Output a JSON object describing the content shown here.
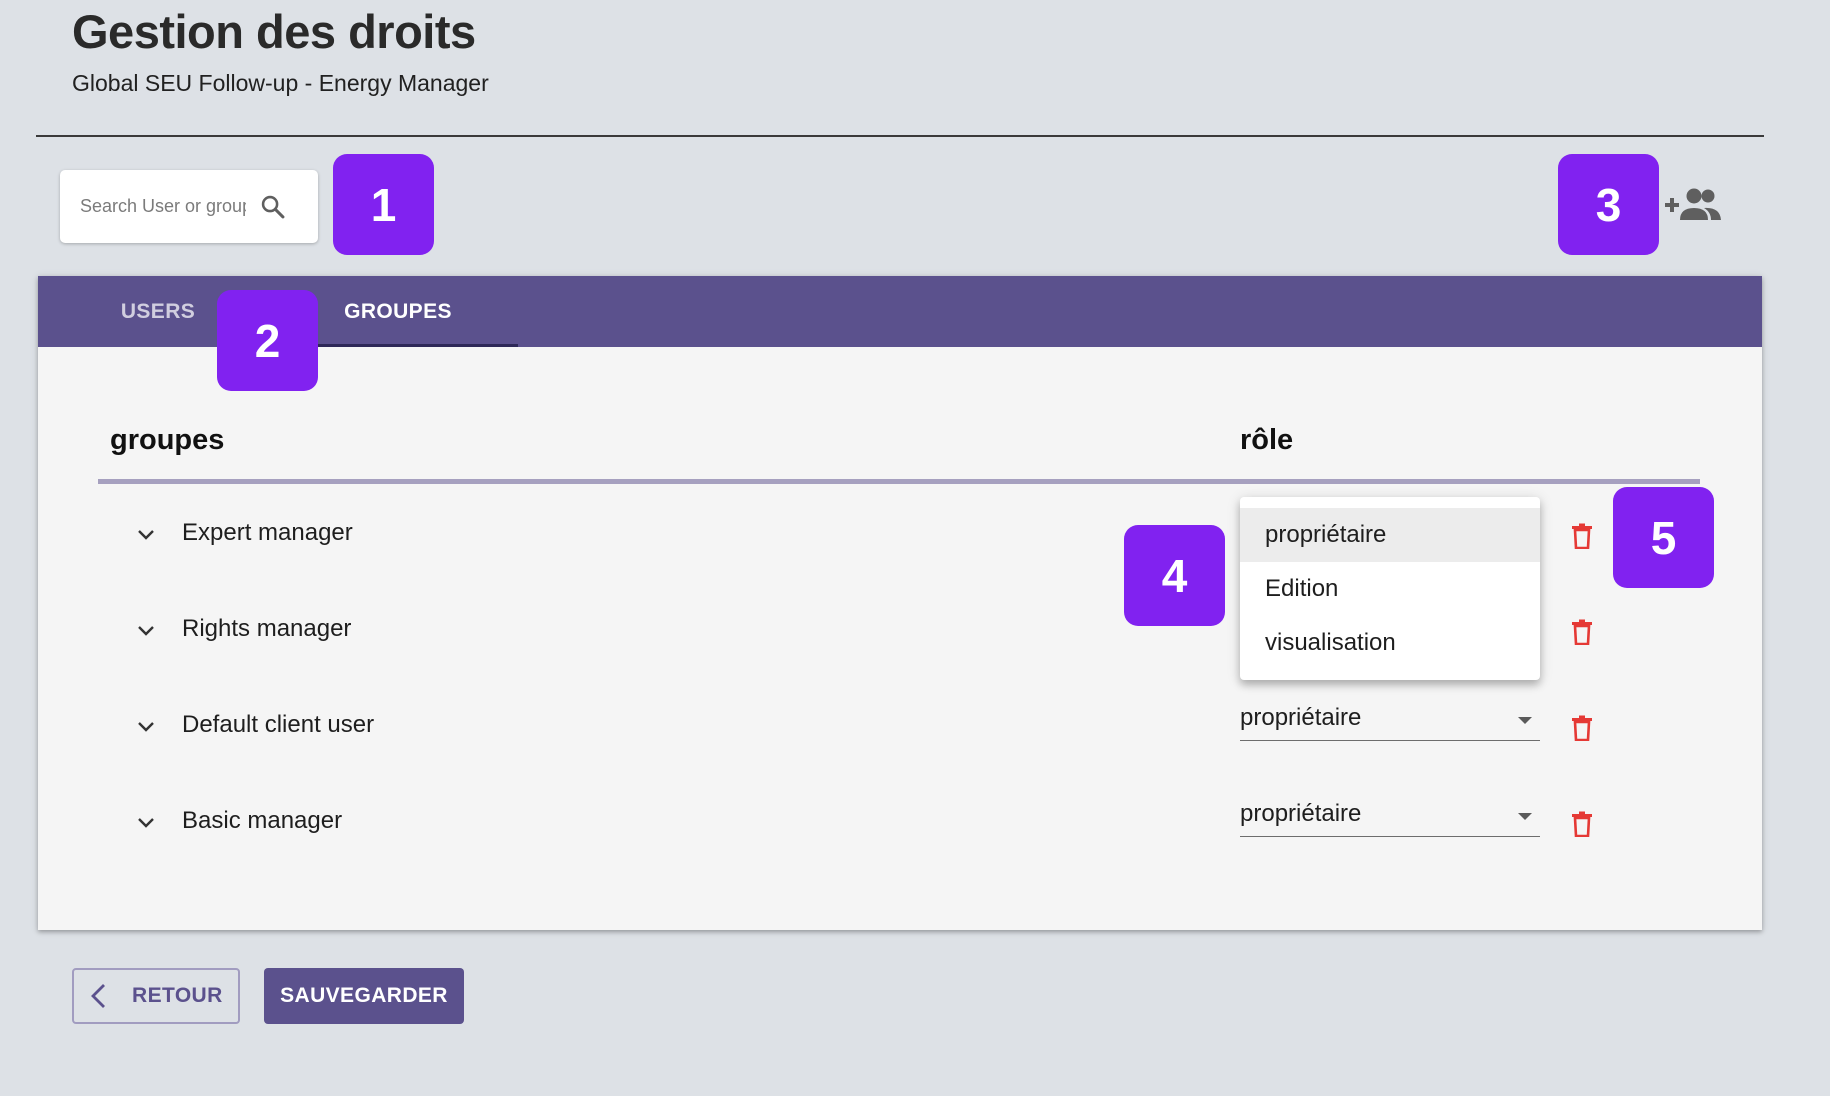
{
  "header": {
    "title": "Gestion des droits",
    "subtitle": "Global SEU Follow-up - Energy Manager"
  },
  "search": {
    "placeholder": "Search User or group",
    "value": "",
    "icon": "search-icon"
  },
  "add_group": {
    "icon": "group-add-icon"
  },
  "tabs": [
    {
      "label": "USERS",
      "active": false
    },
    {
      "label": "GROUPES",
      "active": true
    }
  ],
  "table": {
    "columns": {
      "name": "groupes",
      "role": "rôle"
    },
    "rows": [
      {
        "name": "Expert manager",
        "role": "propriétaire",
        "dropdown_open": true
      },
      {
        "name": "Rights manager",
        "role": "propriétaire"
      },
      {
        "name": "Default client user",
        "role": "propriétaire"
      },
      {
        "name": "Basic manager",
        "role": "propriétaire"
      }
    ]
  },
  "role_dropdown": {
    "options": [
      "propriétaire",
      "Edition",
      "visualisation"
    ],
    "selected": "propriétaire"
  },
  "annotations": [
    "1",
    "2",
    "3",
    "4",
    "5"
  ],
  "footer": {
    "back_label": "RETOUR",
    "save_label": "SAUVEGARDER"
  },
  "colors": {
    "background": "#dde1e6",
    "primary": "#5b518d",
    "annotation_badge": "#8122f0",
    "delete": "#e53935",
    "card": "#f5f5f5"
  }
}
